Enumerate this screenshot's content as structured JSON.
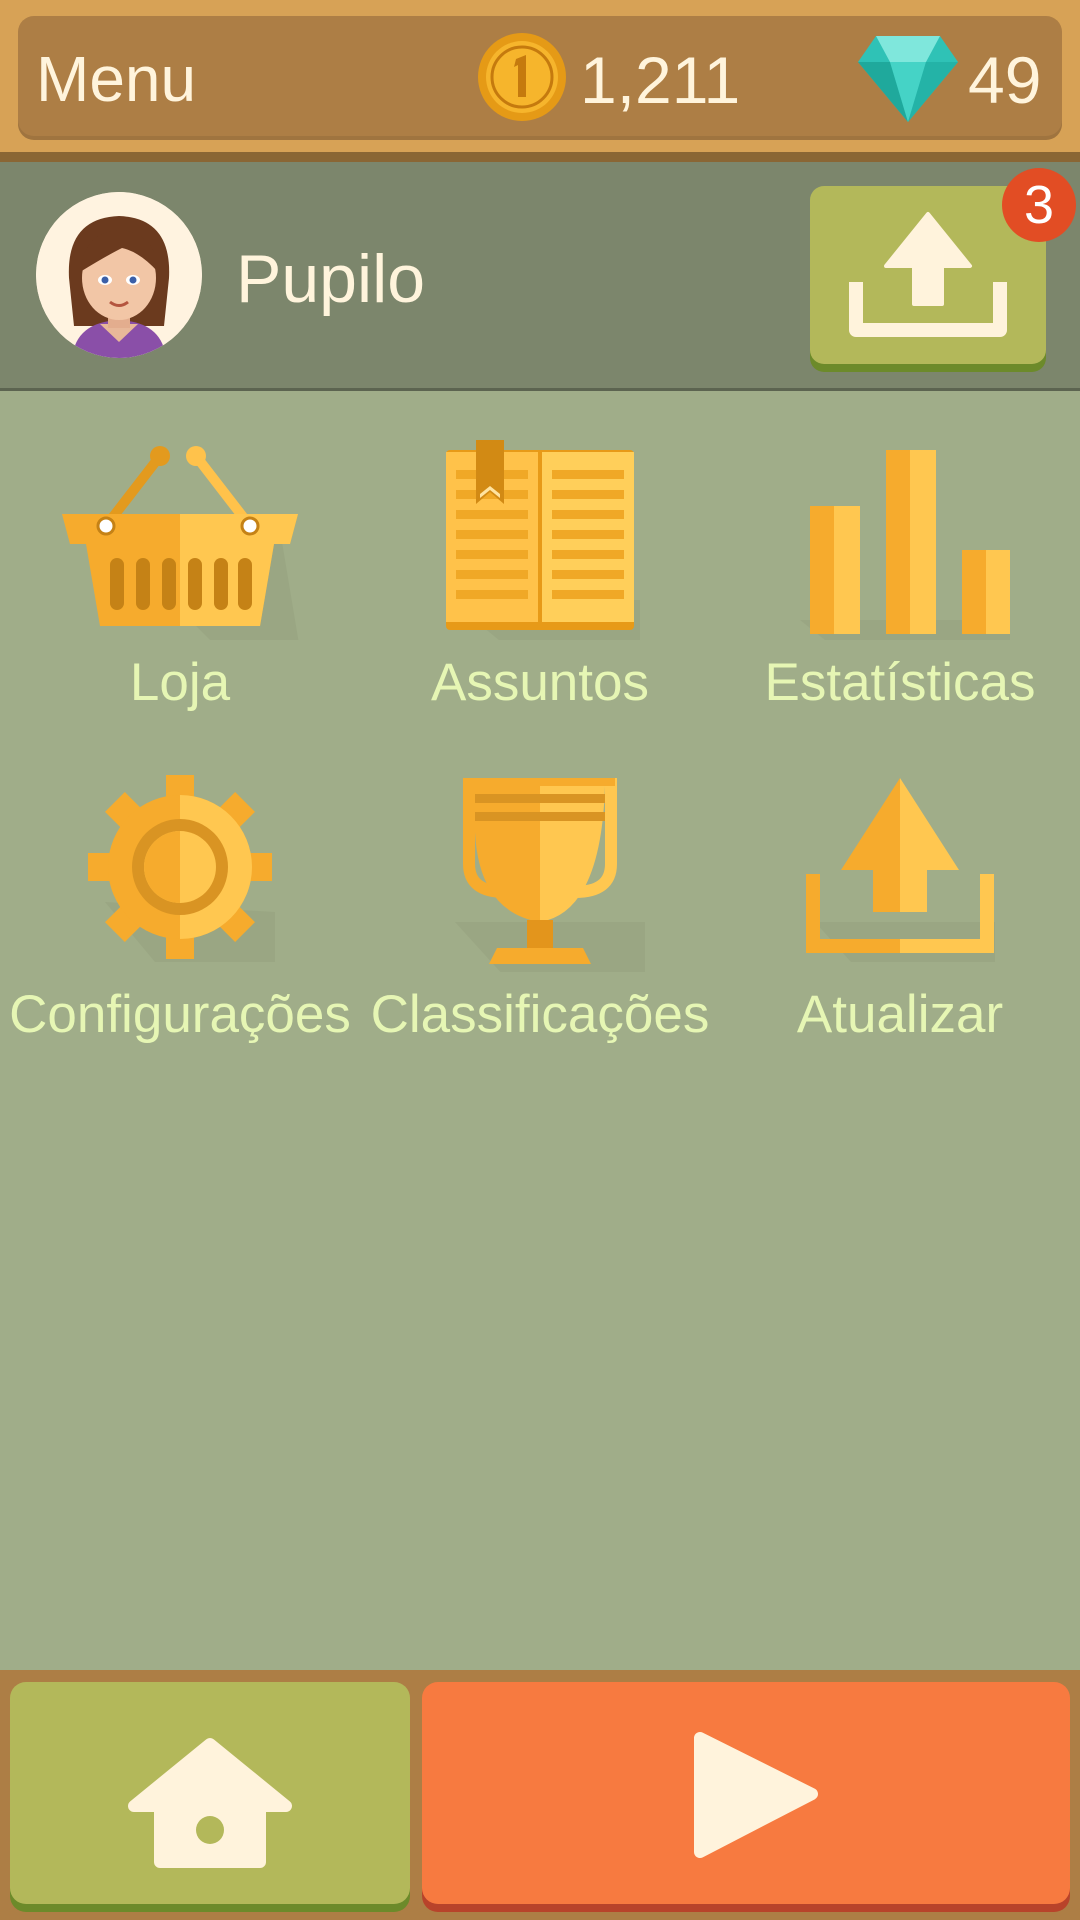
{
  "header": {
    "title": "Menu",
    "coins": "1,211",
    "gems": "49",
    "coin_icon": "coin-icon",
    "gem_icon": "diamond-icon"
  },
  "profile": {
    "name": "Pupilo",
    "avatar_icon": "user-avatar",
    "upload_badge": "3",
    "upload_icon": "upload-icon"
  },
  "menu": {
    "items": [
      {
        "label": "Loja",
        "icon": "basket-icon"
      },
      {
        "label": "Assuntos",
        "icon": "book-icon"
      },
      {
        "label": "Estatísticas",
        "icon": "bar-chart-icon"
      },
      {
        "label": "Configurações",
        "icon": "gear-icon"
      },
      {
        "label": "Classificações",
        "icon": "trophy-icon"
      },
      {
        "label": "Atualizar",
        "icon": "upload-icon"
      }
    ]
  },
  "footer": {
    "home_icon": "home-icon",
    "play_icon": "play-icon"
  },
  "colors": {
    "background": "#a0ad89",
    "accent_orange": "#f77a40",
    "accent_green": "#b3b85a",
    "icon_gold": "#ffb73b",
    "label_green": "#e6f6b4"
  }
}
